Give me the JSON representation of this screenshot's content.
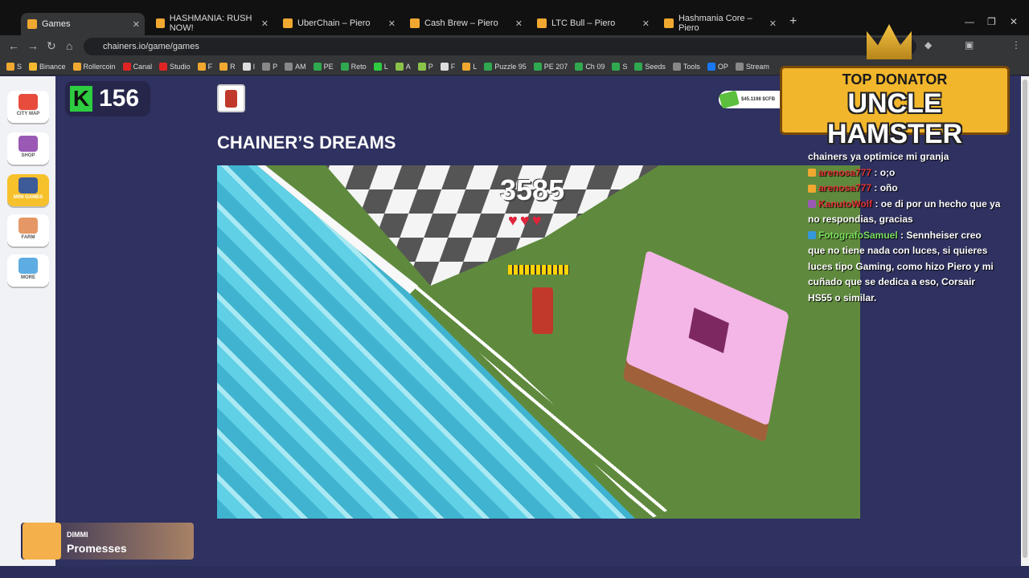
{
  "browser": {
    "tabs": [
      {
        "label": "Games"
      },
      {
        "label": "HASHMANIA: RUSH NOW!"
      },
      {
        "label": "UberChain – Piero"
      },
      {
        "label": "Cash Brew – Piero"
      },
      {
        "label": "LTC Bull – Piero"
      },
      {
        "label": "Hashmania Core – Piero"
      }
    ],
    "url": "chainers.io/game/games",
    "bookmarks": [
      "S",
      "Binance",
      "Rollercoin",
      "Canal",
      "Studio",
      "F",
      "R",
      "I",
      "P",
      "AM",
      "PE",
      "Reto",
      "L",
      "A",
      "P",
      "F",
      "L",
      "Puzzle 95",
      "PE 207",
      "Ch 09",
      "S",
      "Seeds",
      "Tools",
      "OP",
      "Stream"
    ]
  },
  "sidebar": {
    "items": [
      {
        "label": "CITY MAP"
      },
      {
        "label": "SHOP"
      },
      {
        "label": "MINI GAMES"
      },
      {
        "label": "FARM"
      },
      {
        "label": "MORE"
      }
    ]
  },
  "header": {
    "score": "156",
    "wallet": "$45.1198 $CFB"
  },
  "main": {
    "title": "CHAINER’S DREAMS",
    "game_score": "3585",
    "hearts": "♥♥♥"
  },
  "overlay": {
    "top_line": "TOP DONATOR",
    "name": "UNCLE HAMSTER"
  },
  "chat": [
    {
      "user": "",
      "text": "chainers ya optimice mi granja"
    },
    {
      "user": "arenosa777",
      "text": ": o;o"
    },
    {
      "user": "arenosa777",
      "text": ": oño"
    },
    {
      "user": "KanutoWolf",
      "text": ": oe di por un hecho que ya no respondias, gracias"
    },
    {
      "user": "FotografoSamuel",
      "text": ": Sennheiser creo que no tiene nada con luces, si quieres luces tipo Gaming, como hizo Piero y mi cuñado que se dedica a eso, Corsair HS55 o similar."
    }
  ],
  "music": {
    "artist": "DIMMI",
    "track": "Promesses"
  }
}
